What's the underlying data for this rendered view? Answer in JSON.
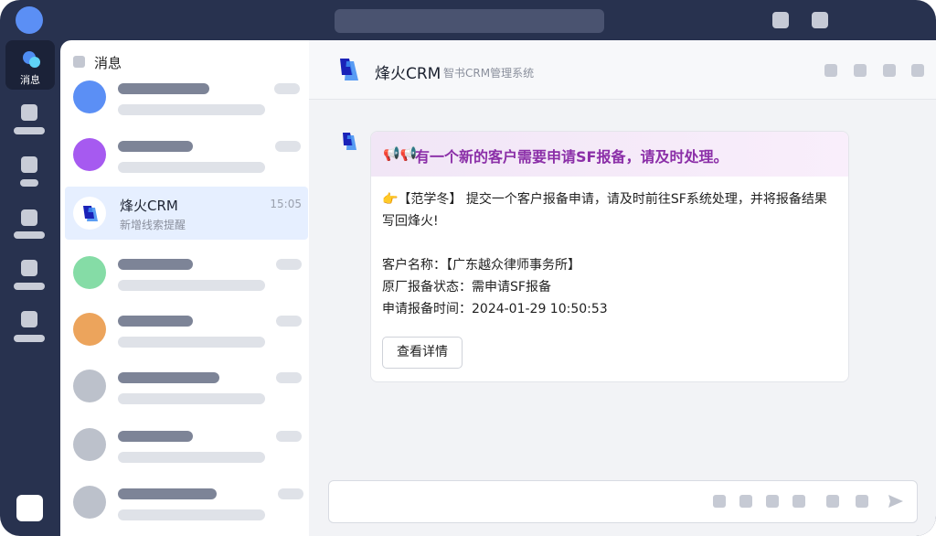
{
  "nav": {
    "active_label": "消息"
  },
  "list": {
    "title": "消息",
    "active_conversation": {
      "name": "烽火CRM",
      "subtitle": "新增线索提醒",
      "time": "15:05"
    }
  },
  "chat": {
    "header": {
      "title": "烽火CRM",
      "subtitle": "智书CRM管理系统"
    },
    "card": {
      "head_icon": "📢📢",
      "head_text": "有一个新的客户需要申请SF报备，请及时处理。",
      "intro": "👉【范学冬】 提交一个客户报备申请，请及时前往SF系统处理，并将报备结果写回烽火!",
      "customer_line": "客户名称：【广东越众律师事务所】",
      "status_line": "原厂报备状态：需申请SF报备",
      "time_line": "申请报备时间：2024-01-29 10:50:53",
      "button": "查看详情"
    }
  },
  "colors": {
    "window_bg": "#28324f",
    "accent_purple": "#8b2fa8",
    "active_row": "#e6efff",
    "avatar_blue": "#5b8ff5",
    "avatar_purple": "#a65af0",
    "avatar_green": "#85dca6",
    "avatar_orange": "#eca45c",
    "avatar_gray": "#bcc1cb"
  },
  "icons": [
    "message-icon",
    "megaphone-icon",
    "pointing-hand-icon",
    "send-icon",
    "app-logo-icon"
  ]
}
